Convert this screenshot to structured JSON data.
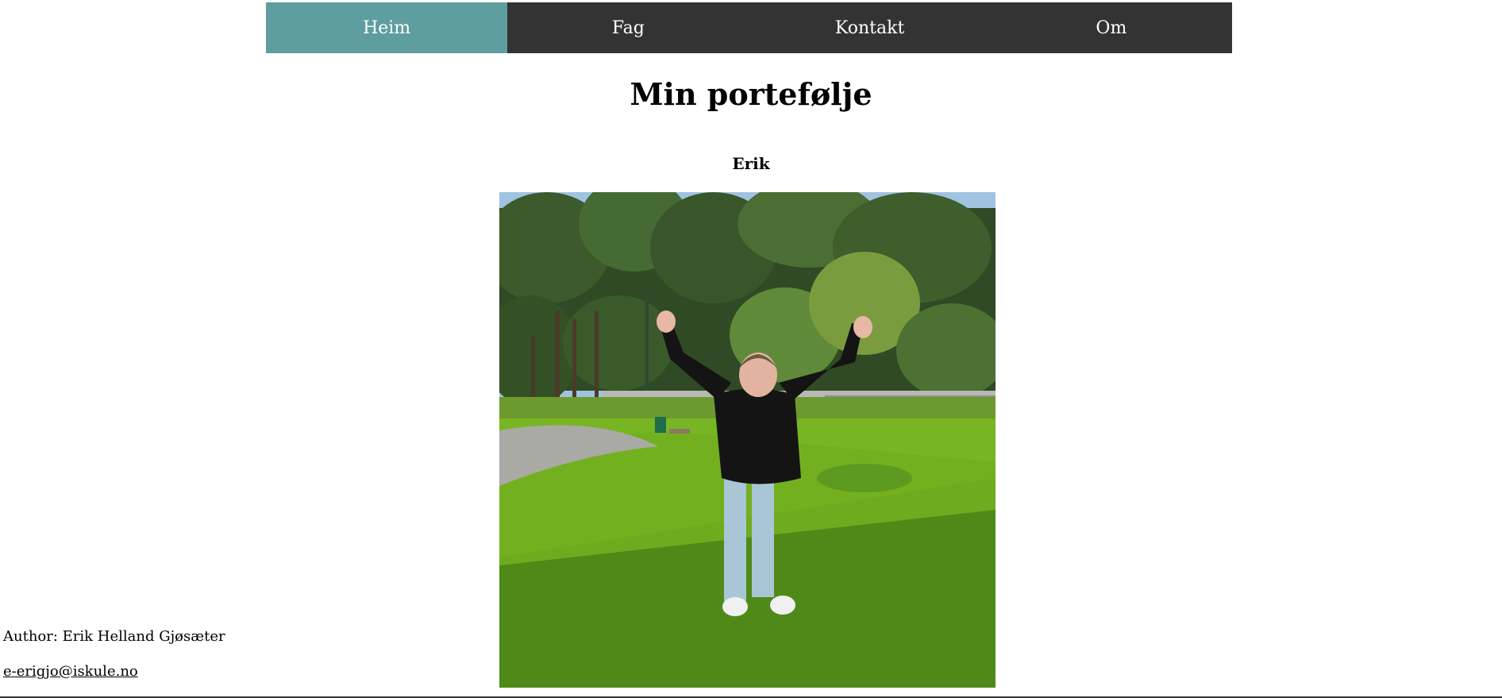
{
  "nav": {
    "items": [
      {
        "label": "Heim",
        "active": true
      },
      {
        "label": "Fag",
        "active": false
      },
      {
        "label": "Kontakt",
        "active": false
      },
      {
        "label": "Om",
        "active": false
      }
    ]
  },
  "main": {
    "title": "Min portefølje",
    "name": "Erik"
  },
  "footer": {
    "author": "Author: Erik Helland Gjøsæter",
    "email": "e-erigjo@iskule.no"
  },
  "colors": {
    "nav_background": "#333333",
    "nav_active": "#5f9ea0",
    "nav_text": "#ffffff"
  }
}
